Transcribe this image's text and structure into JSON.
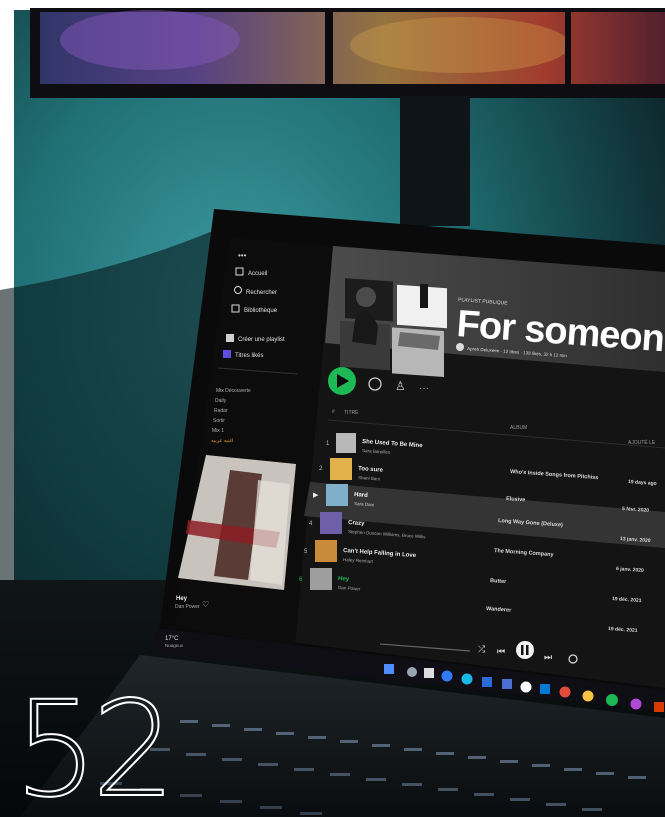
{
  "page_number": "52",
  "laptop_screen": {
    "app": "Spotify",
    "sidebar": {
      "dots": "•••",
      "nav": [
        "Accueil",
        "Rechercher",
        "Bibliothèque"
      ],
      "actions": [
        "Créer une playlist",
        "Titres likés"
      ],
      "playlists": [
        "Mix Découverte",
        "Daily",
        "Radar",
        "Sortir",
        "Mix 1",
        "اغنيه عربيه"
      ],
      "now_playing": {
        "title": "Hey",
        "artist": "Dan Power"
      }
    },
    "playlist": {
      "kind": "PLAYLIST PUBLIQUE",
      "title": "For someone s",
      "meta": "Apreb Deluxeee · 12 titres · 138 likes, 32 h 12 min",
      "column_header_title": "TITRE",
      "column_header_album": "ALBUM",
      "column_header_added": "AJOUTÉ LE",
      "tracks": [
        {
          "num": "1",
          "title": "She Used To Be Mine",
          "artist": "Sara Bareilles",
          "album": "",
          "added": ""
        },
        {
          "num": "2",
          "title": "Too sure",
          "artist": "Shani Bani",
          "album": "Who's Inside Songs from Pitchiss",
          "added": "19 days ago"
        },
        {
          "num": "▶",
          "title": "Hard",
          "artist": "Sara Dani",
          "album": "Elusive",
          "added": "5 févr. 2020"
        },
        {
          "num": "4",
          "title": "Crazy",
          "artist": "Stephen Duncan Williams, Bruce Willis",
          "album": "Long Way Gone (Deluxe)",
          "added": "13 janv. 2020"
        },
        {
          "num": "5",
          "title": "Can't Help Falling in Love",
          "artist": "Haley Reinhart",
          "album": "The Morning Company",
          "added": "6 janv. 2020"
        },
        {
          "num": "6",
          "title": "Hey",
          "artist": "Dan Power",
          "album": "Butter",
          "added": "19 déc. 2021"
        },
        {
          "num": "",
          "title": "",
          "artist": "",
          "album": "Wanderer",
          "added": "19 déc. 2021"
        }
      ]
    },
    "status": {
      "wifi": "17°C",
      "label": "Nuageux"
    }
  },
  "colors": {
    "wall": "#1f6f73",
    "spotify_green": "#1db954",
    "screen_bg": "#141414",
    "number_stroke": "#ffffff"
  }
}
